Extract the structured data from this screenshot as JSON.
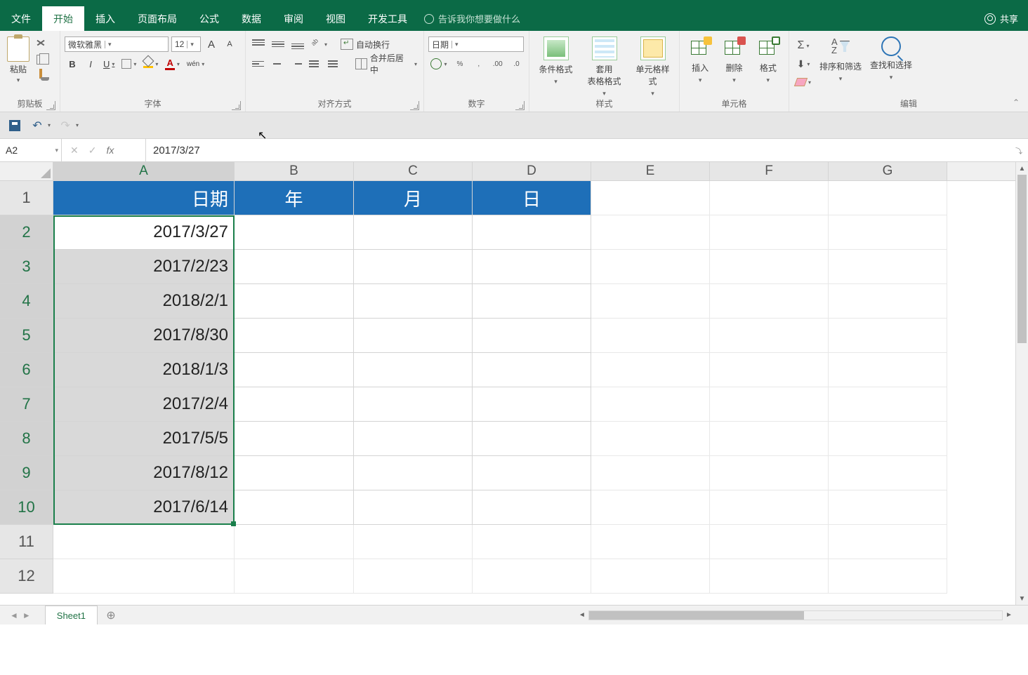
{
  "app": {
    "share": "共享"
  },
  "tabs": {
    "file": "文件",
    "home": "开始",
    "insert": "插入",
    "layout": "页面布局",
    "formulas": "公式",
    "data": "数据",
    "review": "审阅",
    "view": "视图",
    "dev": "开发工具",
    "tellme": "告诉我你想要做什么"
  },
  "ribbon": {
    "clipboard": {
      "paste": "粘贴",
      "label": "剪贴板"
    },
    "font": {
      "name": "微软雅黑",
      "size": "12",
      "increase": "A",
      "decrease": "A",
      "bold": "B",
      "italic": "I",
      "underline": "U",
      "phonetic": "wén",
      "fontcolor": "A",
      "label": "字体"
    },
    "align": {
      "wrap": "自动换行",
      "merge": "合并后居中",
      "label": "对齐方式"
    },
    "number": {
      "format": "日期",
      "percent": "%",
      "comma": ",",
      "inc": ".00",
      "dec": ".0",
      "label": "数字"
    },
    "styles": {
      "cond": "条件格式",
      "table": "套用\n表格格式",
      "cell": "单元格样式",
      "label": "样式"
    },
    "cells": {
      "insert": "插入",
      "delete": "删除",
      "format": "格式",
      "label": "单元格"
    },
    "editing": {
      "sigma": "Σ",
      "sort": "排序和筛选",
      "find": "查找和选择",
      "label": "编辑"
    }
  },
  "namebox": "A2",
  "fx_cancel": "✕",
  "fx_ok": "✓",
  "fx_label": "fx",
  "formula": "2017/3/27",
  "columns": [
    "A",
    "B",
    "C",
    "D",
    "E",
    "F",
    "G"
  ],
  "rownums": [
    "1",
    "2",
    "3",
    "4",
    "5",
    "6",
    "7",
    "8",
    "9",
    "10",
    "11",
    "12"
  ],
  "headers": {
    "A": "日期",
    "B": "年",
    "C": "月",
    "D": "日"
  },
  "data_A": [
    "2017/3/27",
    "2017/2/23",
    "2018/2/1",
    "2017/8/30",
    "2018/1/3",
    "2017/2/4",
    "2017/5/5",
    "2017/8/12",
    "2017/6/14"
  ],
  "sheettab": "Sheet1",
  "newsheet": "⊕",
  "nav": {
    "first": "◄",
    "prev": "◄",
    "next": "►",
    "last": "►"
  }
}
